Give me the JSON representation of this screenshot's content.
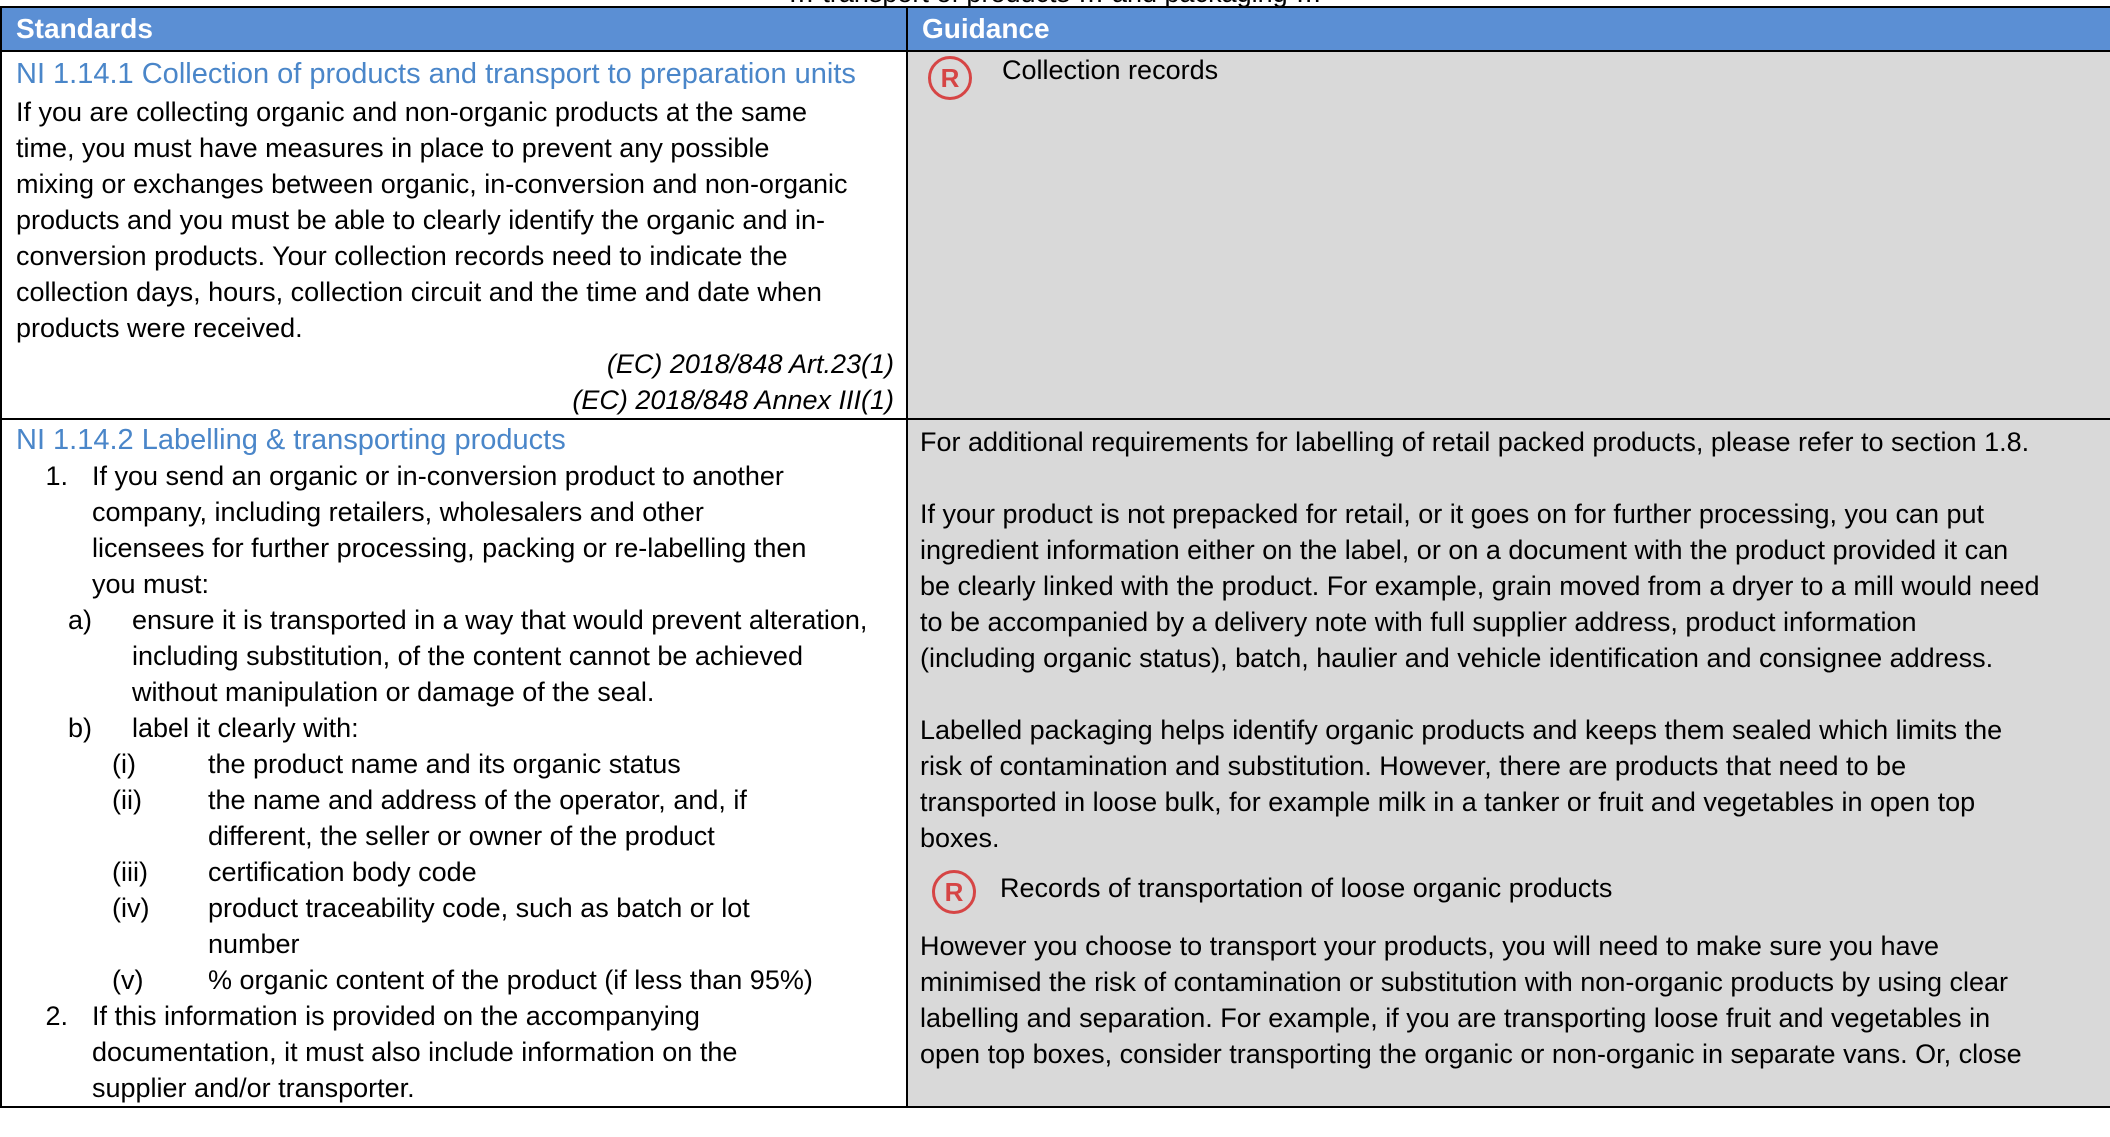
{
  "header": {
    "clipped_heading": "… transport of products … and packaging …",
    "col_standards": "Standards",
    "col_guidance": "Guidance"
  },
  "row1": {
    "title": "NI 1.14.1 Collection of products and transport to preparation units",
    "body_lines": [
      "If you are collecting organic and non-organic products at the same",
      "time, you must have measures in place to prevent any possible",
      "mixing or exchanges between organic, in-conversion and non-organic",
      "products and you must be able to clearly identify the organic and in-",
      "conversion products. Your collection records need to indicate the",
      "collection days, hours, collection circuit and the time and date when",
      "products were received."
    ],
    "citations": [
      "(EC) 2018/848 Art.23(1)",
      "(EC) 2018/848 Annex III(1)"
    ],
    "guidance_icon": "R",
    "guidance_record": "Collection records"
  },
  "row2": {
    "title": "NI 1.14.2 Labelling & transporting products",
    "item1_num": "1.",
    "item1_lines": [
      "If you send an organic or in-conversion product to another",
      "company, including retailers, wholesalers and other",
      "licensees for further processing, packing or re-labelling then",
      "you must:"
    ],
    "item_a_num": "a)",
    "item_a_lines": [
      "ensure it is transported in a way that would prevent alteration,",
      "including substitution, of the content cannot be achieved",
      "without manipulation or damage of the seal."
    ],
    "item_b_num": "b)",
    "item_b_text": "label it clearly with:",
    "roman_items": [
      {
        "num": "(i)",
        "lines": [
          "the product name and its organic status"
        ]
      },
      {
        "num": "(ii)",
        "lines": [
          "the name and address of the operator, and, if",
          "different, the seller or owner of the product"
        ]
      },
      {
        "num": "(iii)",
        "lines": [
          "certification body code"
        ]
      },
      {
        "num": "(iv)",
        "lines": [
          "product traceability code, such as batch or lot",
          "number"
        ]
      },
      {
        "num": "(v)",
        "lines": [
          "% organic content of the product (if less than 95%)"
        ]
      }
    ],
    "item2_num": "2.",
    "item2_lines": [
      "If this information is provided on the accompanying",
      "documentation, it must also include information on the",
      "supplier and/or transporter."
    ],
    "guidance_p1": "For additional requirements for labelling of retail packed products, please refer to section 1.8.",
    "guidance_p2_lines": [
      "If your product is not prepacked for retail, or it goes on for further processing, you can put",
      "ingredient information either on the label, or on a document with the product provided it can",
      "be clearly linked with the product. For example, grain moved from a dryer to a mill would need",
      "to be accompanied by a delivery note with full supplier address, product information",
      "(including organic status), batch, haulier and vehicle identification and consignee address."
    ],
    "guidance_p3_lines": [
      "Labelled packaging helps identify organic products and keeps them sealed which limits the",
      "risk of contamination and substitution. However, there are products that need to be",
      "transported in loose bulk, for example milk in a tanker or fruit and vegetables in open top",
      "boxes."
    ],
    "guidance_icon": "R",
    "guidance_record": "Records of transportation of loose organic products",
    "guidance_p4_lines": [
      "However you choose to transport your products, you will need to make sure you have",
      "minimised the risk of contamination or substitution with non-organic products by using clear",
      "labelling and separation.  For example, if you are transporting loose fruit and vegetables in",
      "open top boxes, consider transporting the organic or non-organic in separate vans.  Or, close"
    ]
  },
  "colors": {
    "header_bg": "#5b8fd4",
    "title_blue": "#4a86c9",
    "guidance_bg": "#d9d9d9",
    "record_icon": "#d64545"
  }
}
